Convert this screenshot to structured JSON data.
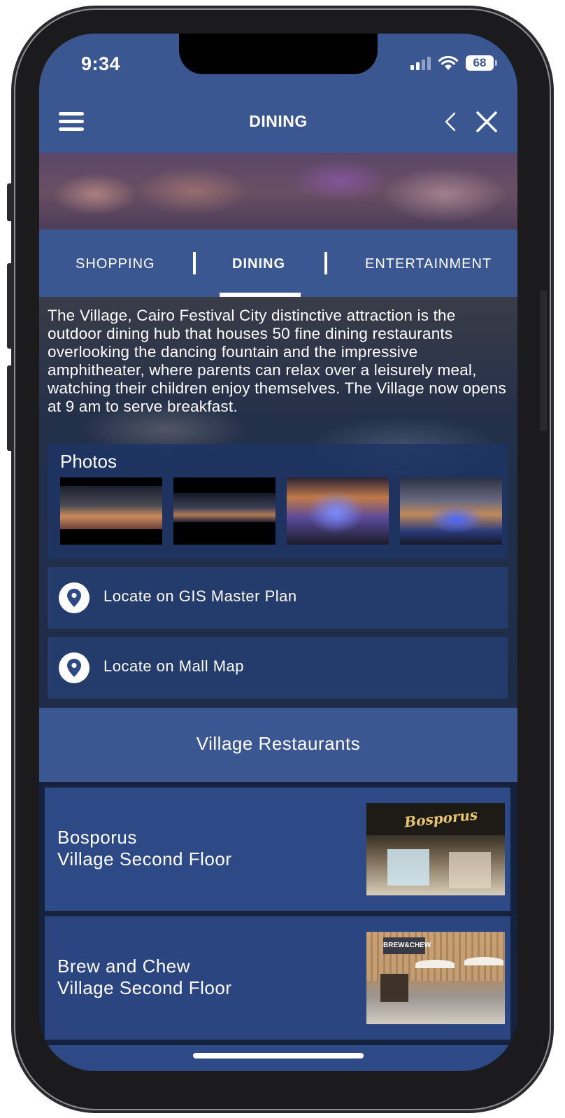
{
  "status_bar": {
    "time": "9:34",
    "battery": "68"
  },
  "header": {
    "title": "DINING"
  },
  "tabs": [
    {
      "label": "SHOPPING",
      "active": false
    },
    {
      "label": "DINING",
      "active": true
    },
    {
      "label": "ENTERTAINMENT",
      "active": false
    }
  ],
  "description": "The Village, Cairo Festival City distinctive attraction is the outdoor dining hub that houses 50 fine dining restaurants overlooking the dancing fountain and the impressive amphitheater, where parents can relax over a leisurely meal, watching their children enjoy themselves. The Village now opens at 9 am to serve breakfast.",
  "photos": {
    "title": "Photos"
  },
  "locate": {
    "gis": "Locate on GIS Master Plan",
    "mall": "Locate on Mall Map"
  },
  "section": {
    "title": "Village Restaurants"
  },
  "restaurants": [
    {
      "name": "Bosporus",
      "location": "Village Second Floor",
      "sign": "Bosporus"
    },
    {
      "name": "Brew and Chew",
      "location": "Village Second Floor",
      "sign": "BREW&CHEW"
    }
  ],
  "colors": {
    "primary": "#3b5791",
    "card": "#2d4a86",
    "dark": "#15223d"
  }
}
